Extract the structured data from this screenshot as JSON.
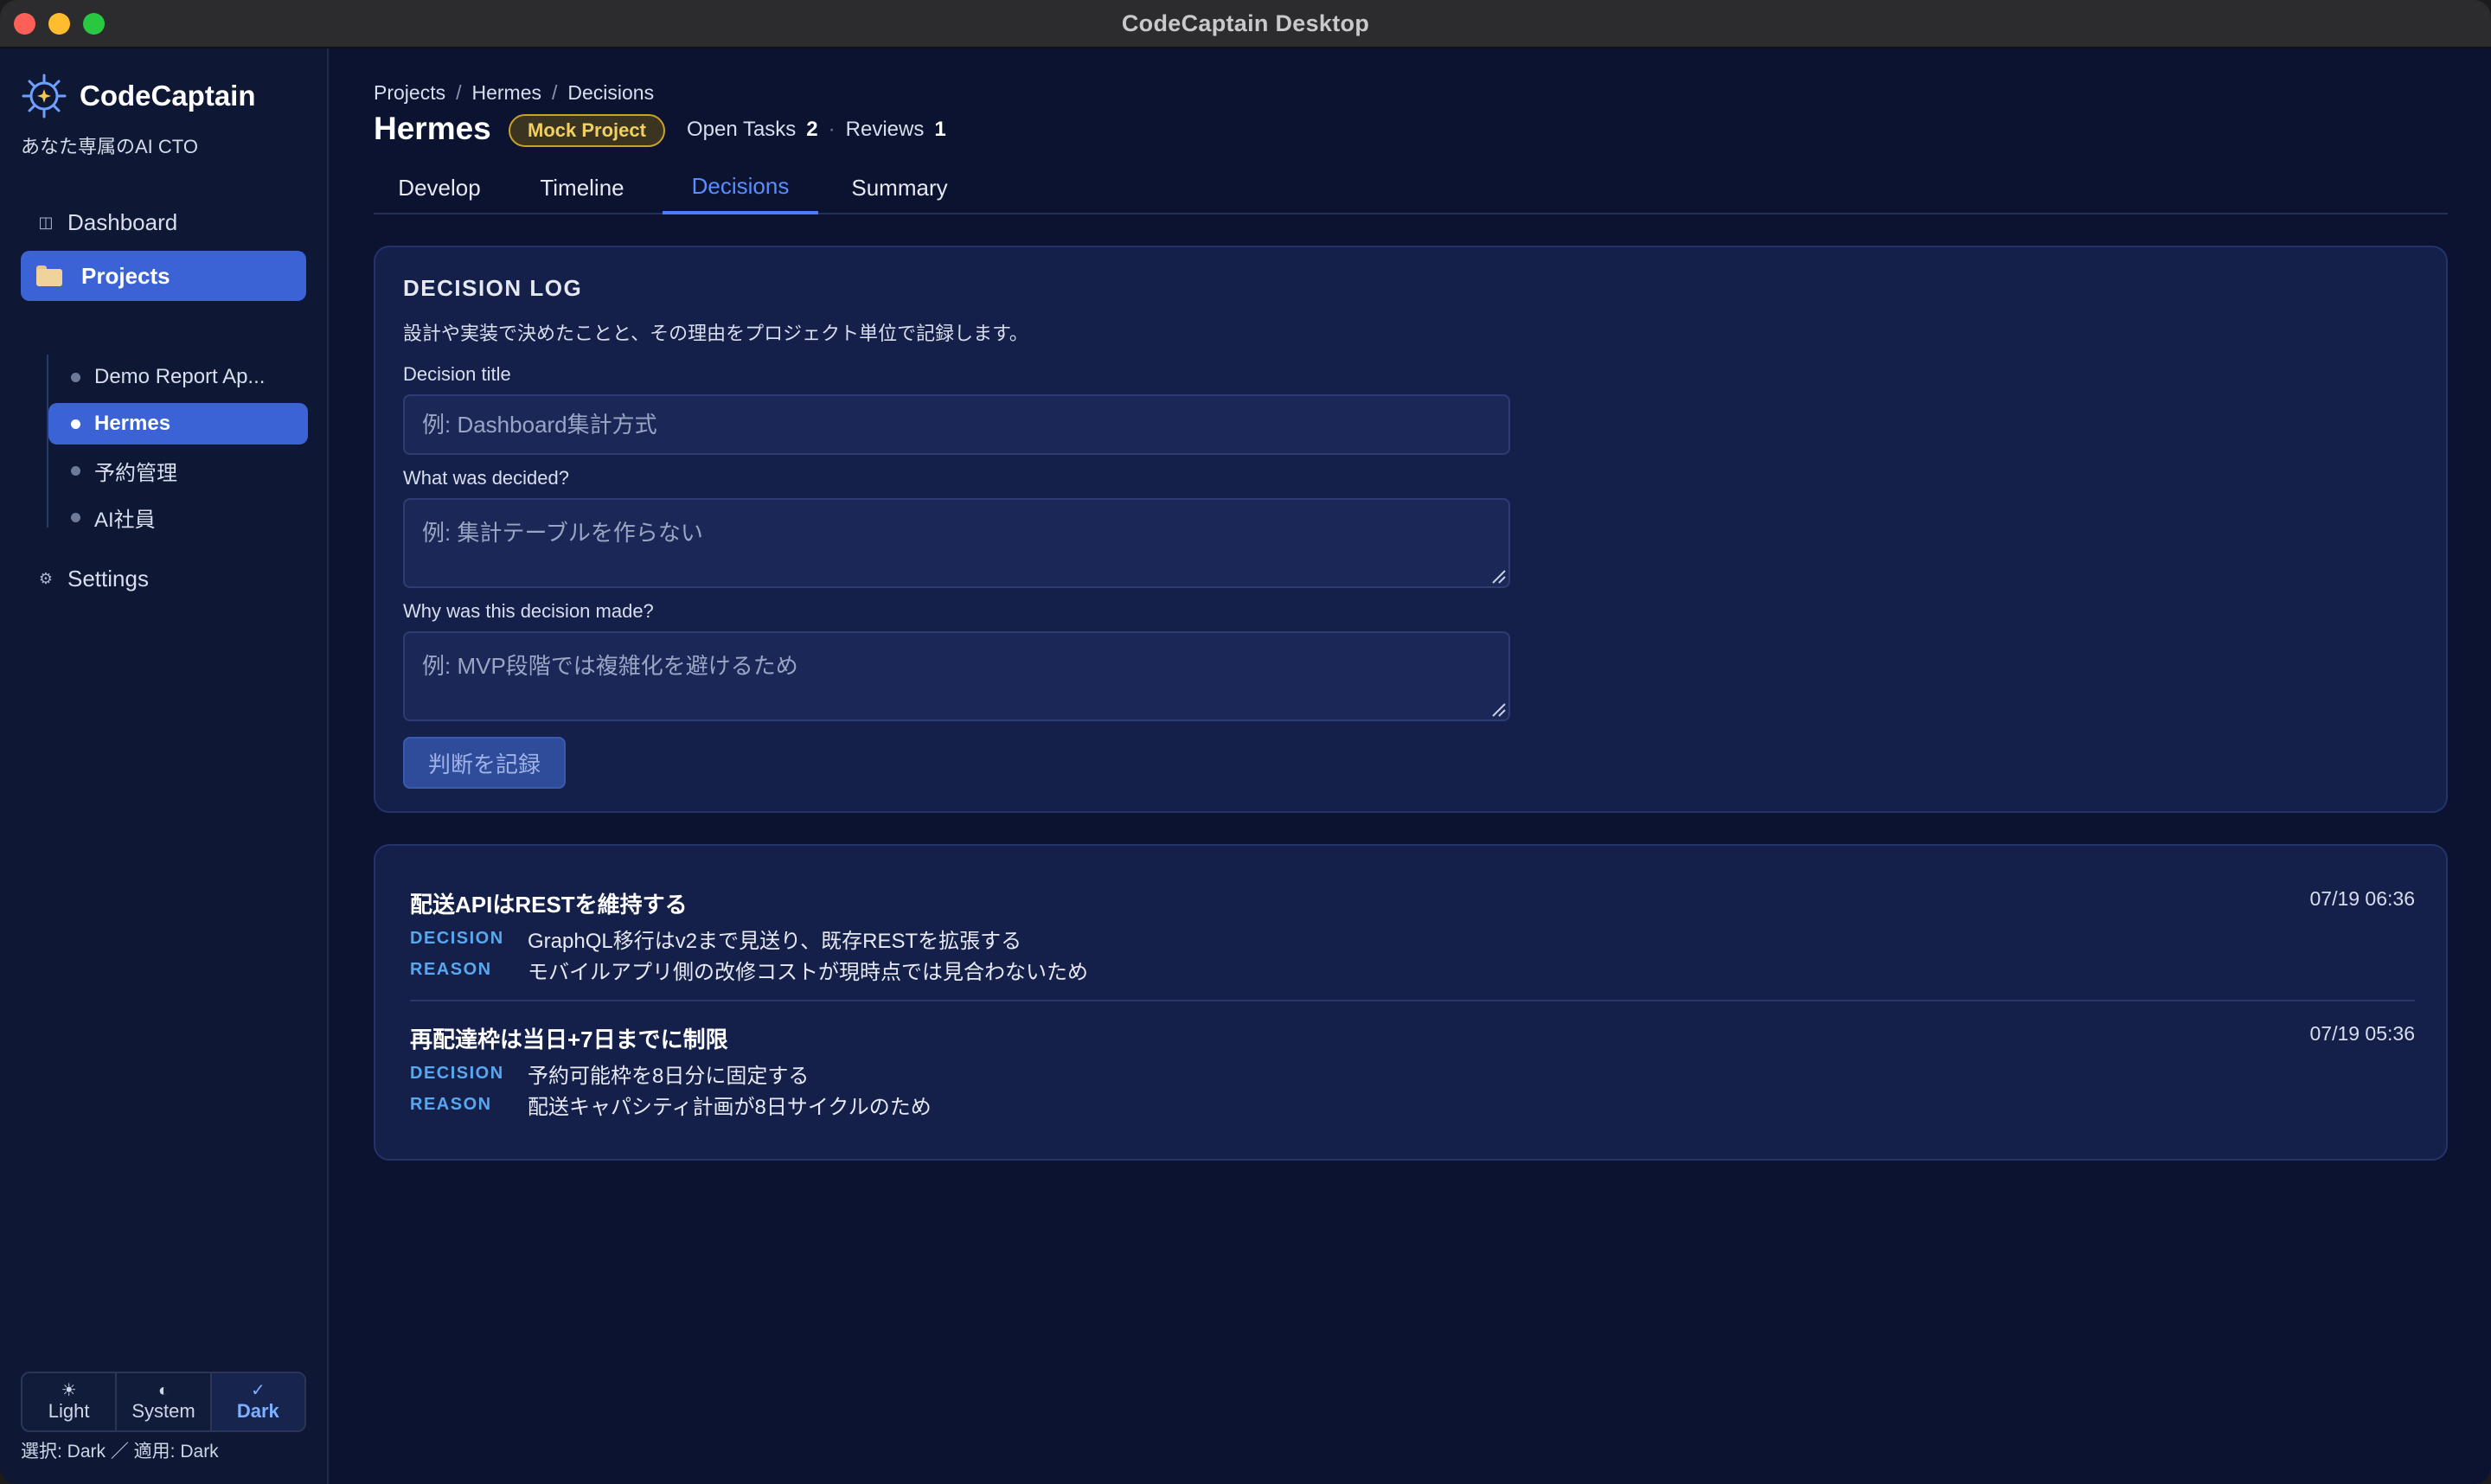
{
  "window": {
    "title": "CodeCaptain Desktop"
  },
  "sidebar": {
    "brand_name": "CodeCaptain",
    "brand_tagline": "あなた専属のAI CTO",
    "nav": {
      "dashboard": "Dashboard",
      "projects": "Projects",
      "settings": "Settings"
    },
    "projects": [
      {
        "label": "Demo Report Ap..."
      },
      {
        "label": "Hermes"
      },
      {
        "label": "予約管理"
      },
      {
        "label": "AI社員"
      }
    ],
    "theme": {
      "options": [
        "Light",
        "System",
        "Dark"
      ],
      "selected": "Dark",
      "status": "選択: Dark ／ 適用: Dark"
    }
  },
  "main": {
    "breadcrumb": [
      "Projects",
      "Hermes",
      "Decisions"
    ],
    "title": "Hermes",
    "badge": "Mock Project",
    "stats": {
      "open_tasks_label": "Open Tasks",
      "open_tasks_value": "2",
      "reviews_label": "Reviews",
      "reviews_value": "1"
    },
    "tabs": [
      "Develop",
      "Timeline",
      "Decisions",
      "Summary"
    ],
    "active_tab": "Decisions",
    "form": {
      "heading": "DECISION LOG",
      "description": "設計や実装で決めたことと、その理由をプロジェクト単位で記録します。",
      "title_label": "Decision title",
      "title_placeholder": "例: Dashboard集計方式",
      "decided_label": "What was decided?",
      "decided_placeholder": "例: 集計テーブルを作らない",
      "reason_label": "Why was this decision made?",
      "reason_placeholder": "例: MVP段階では複雑化を避けるため",
      "submit_label": "判断を記録"
    },
    "decisions": [
      {
        "title": "配送APIはRESTを維持する",
        "time": "07/19 06:36",
        "decision_key": "DECISION",
        "decision": "GraphQL移行はv2まで見送り、既存RESTを拡張する",
        "reason_key": "REASON",
        "reason": "モバイルアプリ側の改修コストが現時点では見合わないため"
      },
      {
        "title": "再配達枠は当日+7日までに制限",
        "time": "07/19 05:36",
        "decision_key": "DECISION",
        "decision": "予約可能枠を8日分に固定する",
        "reason_key": "REASON",
        "reason": "配送キャパシティ計画が8日サイクルのため"
      }
    ]
  },
  "colors": {
    "accent": "#3b63d6",
    "tab_active": "#5a8dff",
    "badge": "#f0cf63",
    "key_label": "#57a8f0",
    "background": "#0b1330"
  }
}
